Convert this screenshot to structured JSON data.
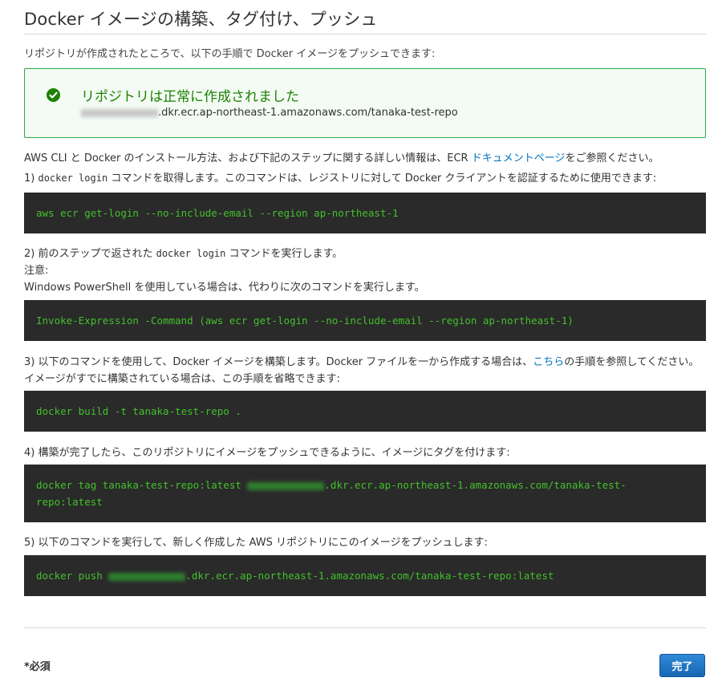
{
  "page": {
    "title": "Docker イメージの構築、タグ付け、プッシュ",
    "intro": "リポジトリが作成されたところで、以下の手順で Docker イメージをプッシュできます:"
  },
  "success": {
    "title": "リポジトリは正常に作成されました",
    "uri_suffix": ".dkr.ecr.ap-northeast-1.amazonaws.com/tanaka-test-repo"
  },
  "info": {
    "before_link": "AWS CLI と Docker のインストール方法、および下記のステップに関する詳しい情報は、ECR ",
    "link": "ドキュメントページ",
    "after_link": "をご参照ください。"
  },
  "steps": {
    "s1": {
      "prefix": "1) ",
      "cmd": "docker login",
      "rest": " コマンドを取得します。このコマンドは、レジストリに対して Docker クライアントを認証するために使用できます:",
      "code": "aws ecr get-login --no-include-email --region ap-northeast-1"
    },
    "s2": {
      "prefix": "2) 前のステップで返された ",
      "cmd": "docker login",
      "rest": " コマンドを実行します。",
      "note": "注意:",
      "note_text": "Windows PowerShell を使用している場合は、代わりに次のコマンドを実行します。",
      "code": "Invoke-Expression -Command (aws ecr get-login --no-include-email --region ap-northeast-1)"
    },
    "s3": {
      "before_link": "3) 以下のコマンドを使用して、Docker イメージを構築します。Docker ファイルを一から作成する場合は、",
      "link": "こちら",
      "after_link": "の手順を参照してください。イメージがすでに構築されている場合は、この手順を省略できます:",
      "code": "docker build -t tanaka-test-repo ."
    },
    "s4": {
      "text": "4) 構築が完了したら、このリポジトリにイメージをプッシュできるように、イメージにタグを付けます:",
      "code_prefix": "docker tag tanaka-test-repo:latest ",
      "code_suffix_line1": ".dkr.ecr.ap-northeast-1.amazonaws.com/tanaka-test-",
      "code_line2": "repo:latest"
    },
    "s5": {
      "text": "5) 以下のコマンドを実行して、新しく作成した AWS リポジトリにこのイメージをプッシュします:",
      "code_prefix": "docker push ",
      "code_suffix": ".dkr.ecr.ap-northeast-1.amazonaws.com/tanaka-test-repo:latest"
    }
  },
  "footer": {
    "required": "*必須",
    "done_button": "完了"
  },
  "colors": {
    "success": "#1d8102",
    "code_bg": "#2a2a2a",
    "code_text": "#43c02c",
    "link": "#0073bb",
    "primary_button": "#1a6fbf"
  },
  "icons": {
    "success": "check-circle-icon"
  }
}
